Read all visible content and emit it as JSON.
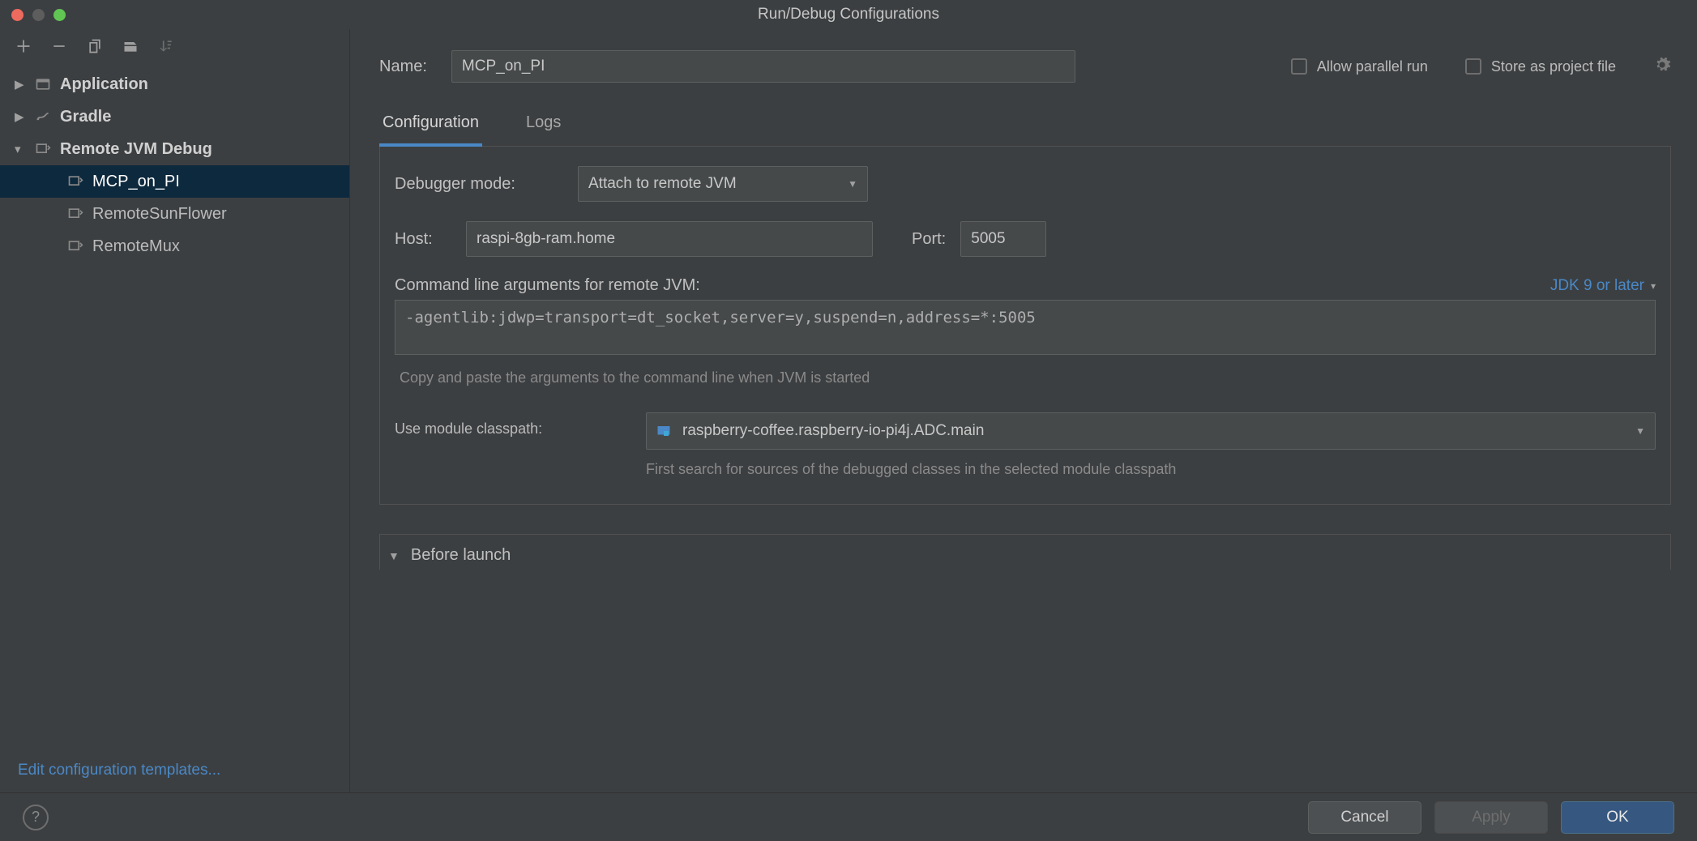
{
  "window": {
    "title": "Run/Debug Configurations"
  },
  "toolbar_icons": [
    "add",
    "remove",
    "copy",
    "save",
    "sort"
  ],
  "tree": {
    "items": [
      {
        "label": "Application",
        "bold": true,
        "expandable": true,
        "expanded": false,
        "depth": 0,
        "icon": "app"
      },
      {
        "label": "Gradle",
        "bold": true,
        "expandable": true,
        "expanded": false,
        "depth": 0,
        "icon": "gradle"
      },
      {
        "label": "Remote JVM Debug",
        "bold": true,
        "expandable": true,
        "expanded": true,
        "depth": 0,
        "icon": "remote"
      },
      {
        "label": "MCP_on_PI",
        "bold": false,
        "expandable": false,
        "depth": 1,
        "icon": "remote",
        "selected": true
      },
      {
        "label": "RemoteSunFlower",
        "bold": false,
        "expandable": false,
        "depth": 1,
        "icon": "remote"
      },
      {
        "label": "RemoteMux",
        "bold": false,
        "expandable": false,
        "depth": 1,
        "icon": "remote"
      }
    ],
    "edit_templates": "Edit configuration templates..."
  },
  "form": {
    "name_label": "Name:",
    "name_value": "MCP_on_PI",
    "allow_parallel": "Allow parallel run",
    "store_project": "Store as project file",
    "tabs": {
      "configuration": "Configuration",
      "logs": "Logs"
    },
    "debugger_label": "Debugger mode:",
    "debugger_value": "Attach to remote JVM",
    "host_label": "Host:",
    "host_value": "raspi-8gb-ram.home",
    "port_label": "Port:",
    "port_value": "5005",
    "cmd_label": "Command line arguments for remote JVM:",
    "jdk_label": "JDK 9 or later",
    "cmd_value": "-agentlib:jdwp=transport=dt_socket,server=y,suspend=n,address=*:5005",
    "cmd_hint": "Copy and paste the arguments to the command line when JVM is started",
    "module_label": "Use module classpath:",
    "module_value": "raspberry-coffee.raspberry-io-pi4j.ADC.main",
    "module_hint": "First search for sources of the debugged classes in the selected module classpath",
    "before_launch": "Before launch"
  },
  "footer": {
    "cancel": "Cancel",
    "apply": "Apply",
    "ok": "OK"
  }
}
